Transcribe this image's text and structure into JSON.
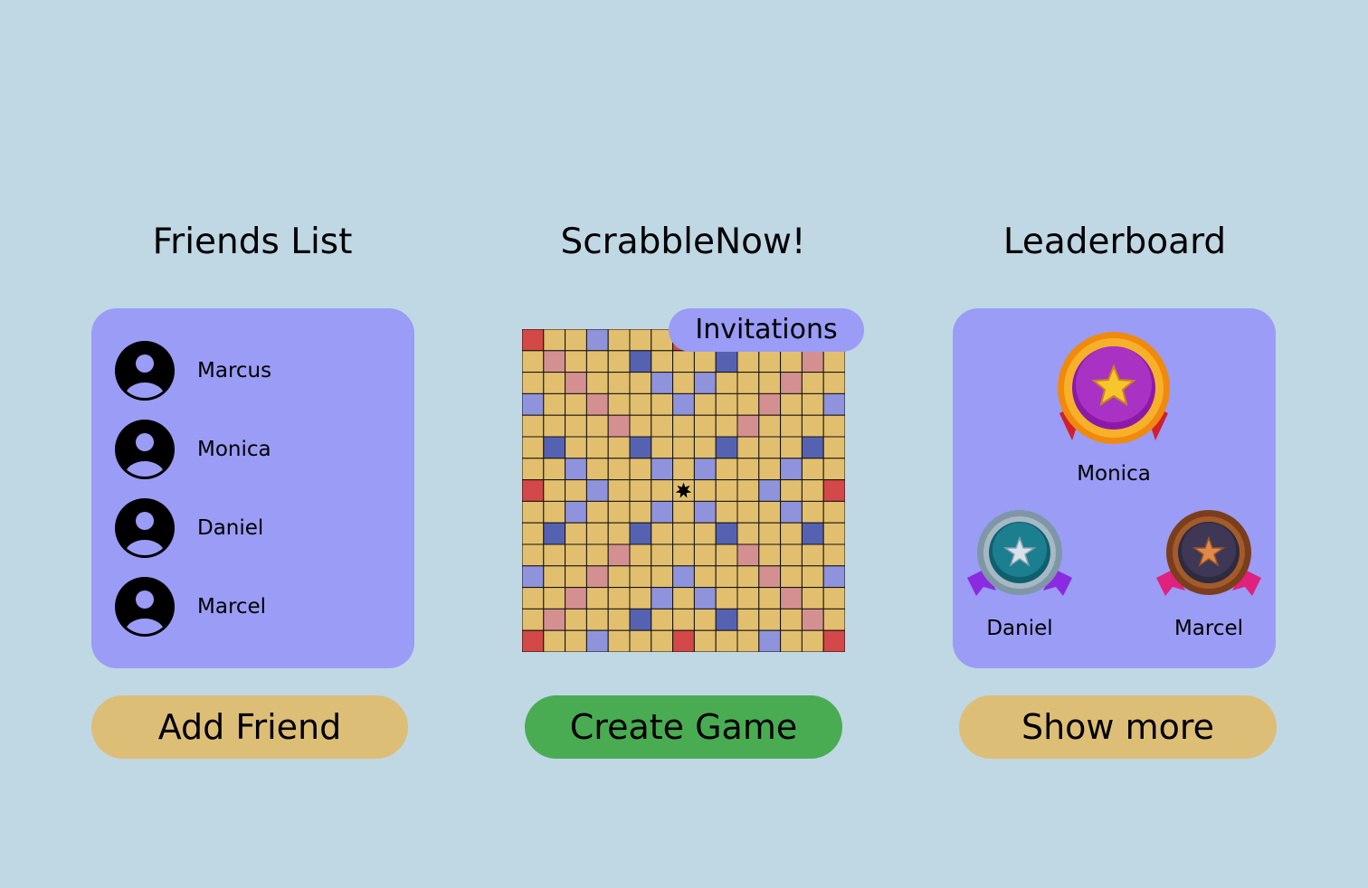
{
  "app": {
    "title": "ScrabbleNow!"
  },
  "friends": {
    "heading": "Friends List",
    "items": [
      {
        "name": "Marcus",
        "icon": "avatar-icon"
      },
      {
        "name": "Monica",
        "icon": "avatar-icon"
      },
      {
        "name": "Daniel",
        "icon": "avatar-icon"
      },
      {
        "name": "Marcel",
        "icon": "avatar-icon"
      }
    ],
    "add_label": "Add Friend"
  },
  "game": {
    "invitations_label": "Invitations",
    "create_label": "Create Game",
    "board_size": 15,
    "center_icon": "star-icon"
  },
  "leaderboard": {
    "heading": "Leaderboard",
    "first": {
      "name": "Monica",
      "icon": "gold-medal-icon"
    },
    "second": {
      "name": "Daniel",
      "icon": "silver-medal-icon"
    },
    "third": {
      "name": "Marcel",
      "icon": "bronze-medal-icon"
    },
    "show_more_label": "Show more"
  },
  "colors": {
    "background": "#c0d7e4",
    "panel": "#9a9cf5",
    "button_gold": "#ddbe76",
    "button_green": "#49ac52",
    "tile": "#e2bf6e",
    "triple_word": "#d34848",
    "double_word": "#d49090",
    "triple_letter": "#5562b2",
    "double_letter": "#8f93dc"
  }
}
